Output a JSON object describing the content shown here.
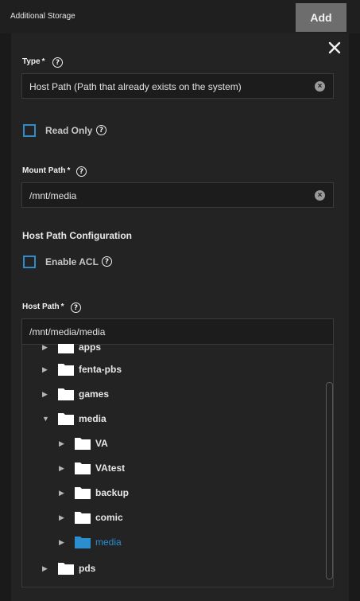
{
  "header": {
    "title": "Additional Storage",
    "add_label": "Add"
  },
  "type_field": {
    "label": "Type",
    "required": "*",
    "value": "Host Path (Path that already exists on the system)"
  },
  "read_only": {
    "label": "Read Only",
    "checked": false
  },
  "mount_path": {
    "label": "Mount Path",
    "required": "*",
    "value": "/mnt/media"
  },
  "host_path_config": {
    "title": "Host Path Configuration",
    "enable_acl": {
      "label": "Enable ACL",
      "checked": false
    }
  },
  "host_path": {
    "label": "Host Path",
    "required": "*",
    "value": "/mnt/media/media"
  },
  "tree": {
    "items": [
      {
        "label": "apps",
        "expanded": false,
        "selected": false,
        "depth": 1
      },
      {
        "label": "fenta-pbs",
        "expanded": false,
        "selected": false,
        "depth": 1
      },
      {
        "label": "games",
        "expanded": false,
        "selected": false,
        "depth": 1
      },
      {
        "label": "media",
        "expanded": true,
        "selected": false,
        "depth": 1
      },
      {
        "label": "VA",
        "expanded": false,
        "selected": false,
        "depth": 2
      },
      {
        "label": "VAtest",
        "expanded": false,
        "selected": false,
        "depth": 2
      },
      {
        "label": "backup",
        "expanded": false,
        "selected": false,
        "depth": 2
      },
      {
        "label": "comic",
        "expanded": false,
        "selected": false,
        "depth": 2
      },
      {
        "label": "media",
        "expanded": false,
        "selected": true,
        "depth": 2
      },
      {
        "label": "pds",
        "expanded": false,
        "selected": false,
        "depth": 1
      }
    ]
  },
  "icons": {
    "close": "close-icon",
    "help": "help-icon",
    "clear": "clear-icon",
    "folder": "folder-icon",
    "expand": "chevron-right-icon",
    "collapse": "chevron-down-icon"
  },
  "colors": {
    "accent": "#2a8ecf",
    "checkbox_border": "#2f8cc8",
    "button_bg": "#6d6d6d",
    "folder_selected": "#2a8ecf",
    "folder_default": "#ffffff"
  }
}
